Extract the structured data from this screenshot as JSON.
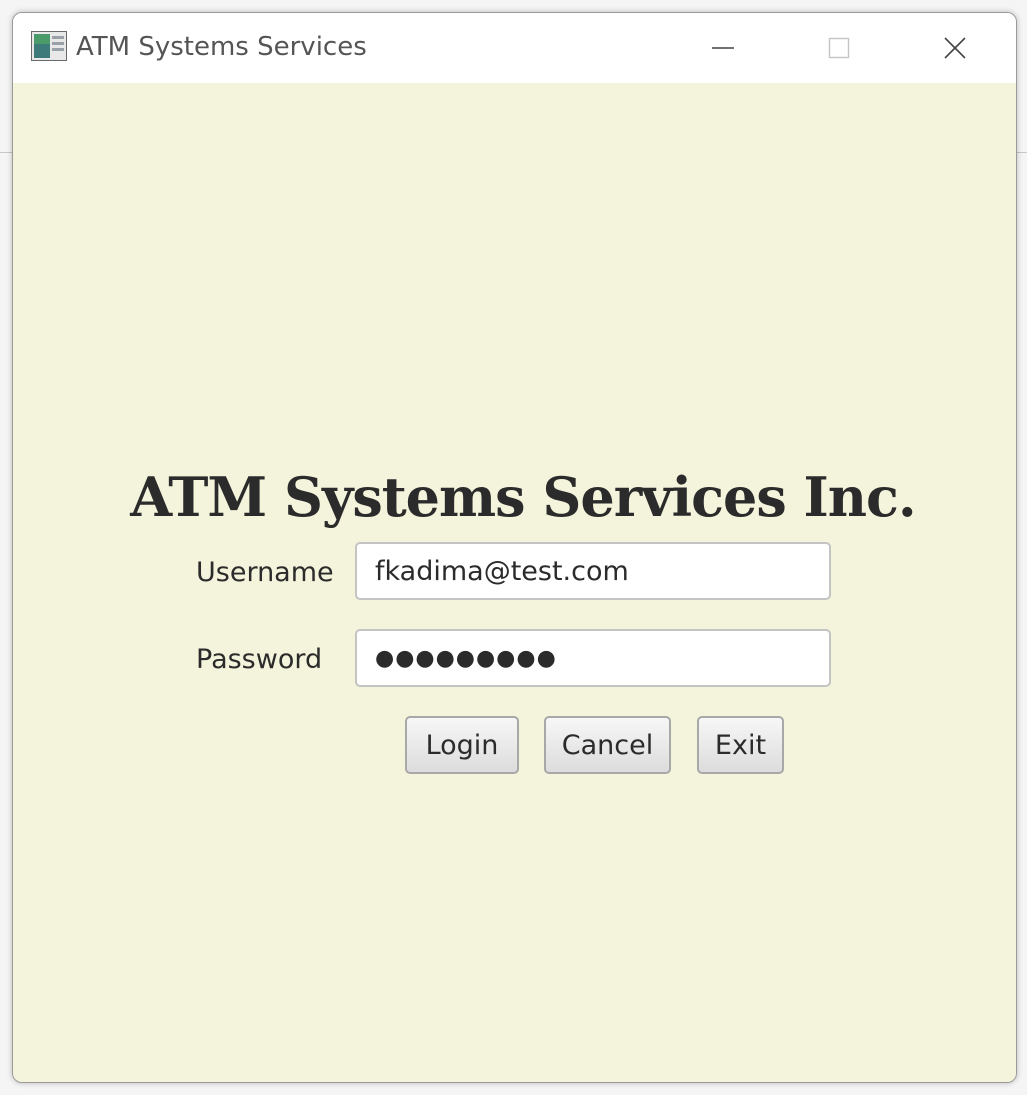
{
  "window": {
    "title": "ATM Systems Services"
  },
  "icons": {
    "app": "app-window-icon",
    "minimize": "minimize-icon",
    "maximize": "maximize-icon",
    "close": "close-icon"
  },
  "login": {
    "heading": "ATM Systems Services Inc.",
    "username_label": "Username",
    "username_value": "fkadima@test.com",
    "password_label": "Password",
    "password_masked": "●●●●●●●●●",
    "buttons": {
      "login": "Login",
      "cancel": "Cancel",
      "exit": "Exit"
    }
  },
  "colors": {
    "content_bg": "#f4f3db",
    "titlebar_bg": "#ffffff"
  }
}
